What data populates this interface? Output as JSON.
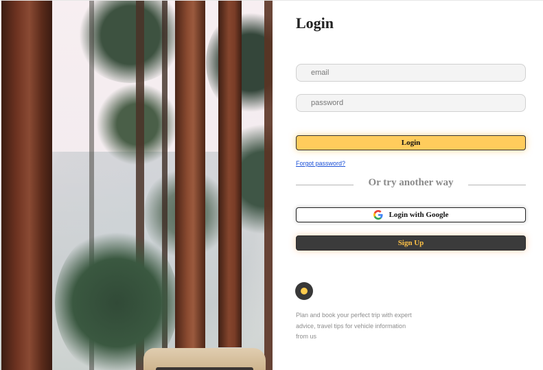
{
  "page": {
    "title": "Login",
    "email_placeholder": "email",
    "password_placeholder": "password",
    "login_button": "Login",
    "forgot_password": "Forgot password?",
    "divider_text": "Or try another way",
    "google_button": "Login with Google",
    "signup_button": "Sign Up",
    "tagline": "Plan and book your perfect trip with expert advice, travel tips for vehicle information from us"
  },
  "icons": {
    "google": "google-logo-icon",
    "brand": "brand-logo-icon"
  },
  "colors": {
    "accent": "#ffcc5c",
    "dark": "#3b3b3b",
    "link": "#1a4fd6",
    "signup_text": "#ffc246"
  }
}
